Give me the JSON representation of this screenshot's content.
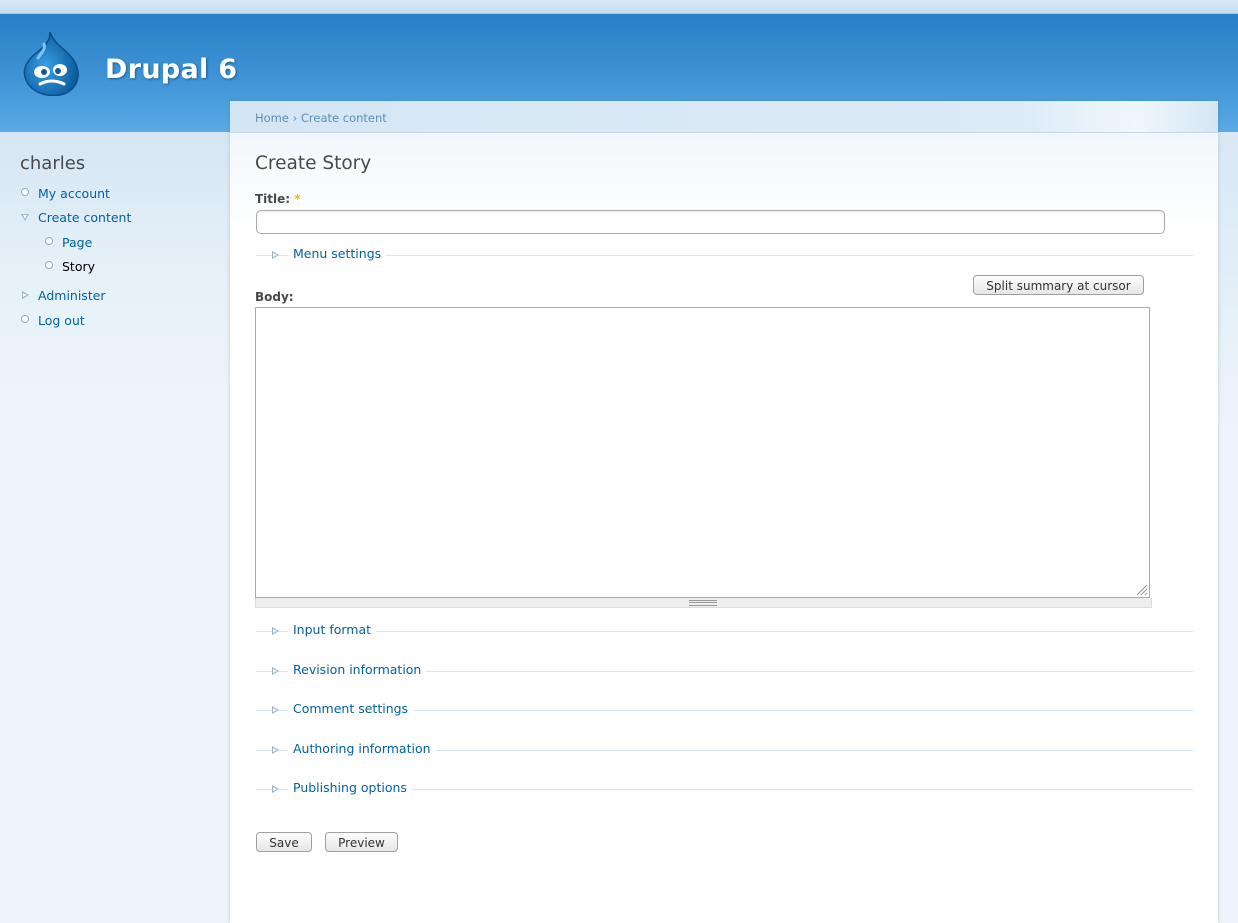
{
  "site": {
    "name": "Drupal 6"
  },
  "sidebar": {
    "user_name": "charles",
    "items": [
      {
        "label": "My account"
      },
      {
        "label": "Create content"
      },
      {
        "label": "Page"
      },
      {
        "label": "Story"
      },
      {
        "label": "Administer"
      },
      {
        "label": "Log out"
      }
    ]
  },
  "breadcrumb": {
    "home": "Home",
    "separator": "›",
    "current": "Create content"
  },
  "page": {
    "title": "Create Story"
  },
  "form": {
    "title_label": "Title:",
    "required_mark": "*",
    "title_value": "",
    "menu_settings": "Menu settings",
    "split_button": "Split summary at cursor",
    "body_label": "Body:",
    "body_value": "",
    "fieldsets": [
      "Input format",
      "Revision information",
      "Comment settings",
      "Authoring information",
      "Publishing options"
    ],
    "save_button": "Save",
    "preview_button": "Preview"
  },
  "colors": {
    "link": "#0062a0",
    "header": "#2780c5",
    "required": "#ffae00"
  }
}
